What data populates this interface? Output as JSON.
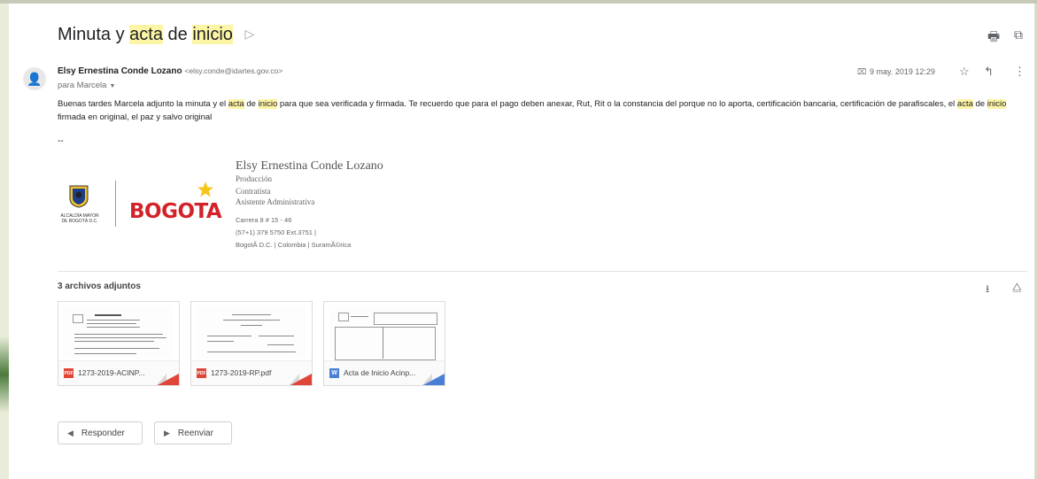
{
  "email": {
    "subject_parts": [
      "Minuta y ",
      "acta",
      " de ",
      "inicio"
    ],
    "sender_name": "Elsy Ernestina Conde Lozano",
    "sender_email": "<elsy.conde@idartes.gov.co>",
    "recipient": "para Marcela",
    "date": "9 may. 2019 12:29",
    "body": {
      "p1": "Buenas tardes Marcela adjunto la minuta y el ",
      "h1": "acta",
      "p2": " de ",
      "h2": "inicio",
      "p3": " para que sea verificada y firmada. Te recuerdo que para el pago deben anexar, Rut, Rit o la constancia del porque no lo aporta, certificación bancaria, certificación de parafiscales, el ",
      "h3": "acta",
      "p4": " de ",
      "h4": "inicio",
      "p5": " firmada en original, el paz y salvo original"
    },
    "sig_separator": "--"
  },
  "signature": {
    "name": "Elsy Ernestina Conde Lozano",
    "dept": "Producción",
    "role1": "Contratista",
    "role2": "Asistente Administrativa",
    "address": "Carrera 8 # 15 - 46",
    "phone": "(57+1) 379 5750 Ext.3751 |",
    "location": "BogotÃ D.C. | Colombia | SuramÃ©rica",
    "crest_caption": "ALCALDÍA MAYOR DE BOGOTÁ D.C.",
    "logo_text": "BOGOTA"
  },
  "attachments": {
    "title": "3 archivos adjuntos",
    "files": [
      {
        "type": "PDF",
        "name": "1273-2019-ACINP..."
      },
      {
        "type": "PDF",
        "name": "1273-2019-RP.pdf"
      },
      {
        "type": "W",
        "name": "Acta de Inicio Acinp..."
      }
    ]
  },
  "actions": {
    "reply": "Responder",
    "forward": "Reenviar"
  },
  "icons": [
    "label-icon",
    "print-icon",
    "open-new-window-icon",
    "avatar-icon",
    "chevron-down-icon",
    "attachment-icon",
    "star-icon",
    "reply-icon",
    "more-vert-icon",
    "download-icon",
    "drive-icon",
    "pdf-icon",
    "word-icon",
    "forward-icon"
  ],
  "colors": {
    "highlight": "#fdf5a6",
    "pdf": "#e0453a",
    "word": "#4a7fd6",
    "bogota_red": "#d3232a"
  }
}
